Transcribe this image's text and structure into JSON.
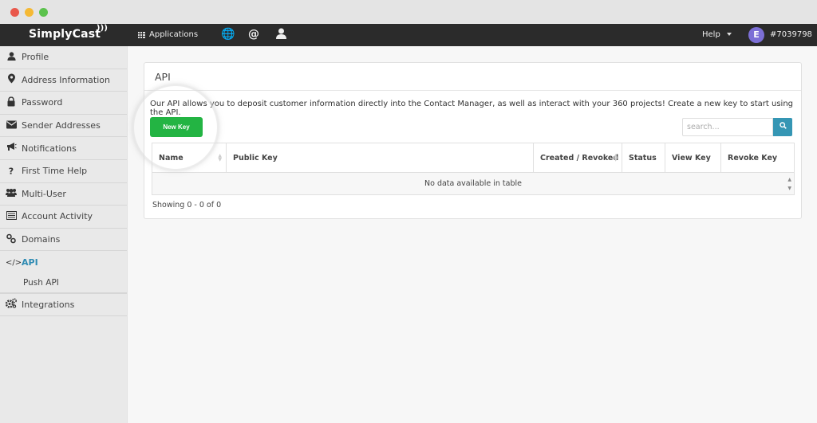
{
  "window": {
    "controls": [
      "close",
      "minimize",
      "maximize"
    ]
  },
  "topnav": {
    "logo": "SimplyCast",
    "applications_label": "Applications",
    "icons": [
      "globe-icon",
      "at-icon",
      "user-icon"
    ],
    "help_label": "Help",
    "avatar_letter": "E",
    "account_id": "#7039798",
    "avatar_color": "#7c6fd6"
  },
  "sidebar": {
    "items": [
      {
        "label": "Profile",
        "icon": "user-icon"
      },
      {
        "label": "Address Information",
        "icon": "map-marker-icon"
      },
      {
        "label": "Password",
        "icon": "lock-icon"
      },
      {
        "label": "Sender Addresses",
        "icon": "envelope-icon"
      },
      {
        "label": "Notifications",
        "icon": "bullhorn-icon"
      },
      {
        "label": "First Time Help",
        "icon": "question-icon"
      },
      {
        "label": "Multi-User",
        "icon": "users-icon"
      },
      {
        "label": "Account Activity",
        "icon": "list-icon"
      },
      {
        "label": "Domains",
        "icon": "link-icon"
      },
      {
        "label": "API",
        "icon": "code-icon",
        "active": true
      },
      {
        "label": "Push API",
        "sub": true
      },
      {
        "label": "Integrations",
        "icon": "cogs-icon"
      }
    ],
    "active_color": "#2e8bb3"
  },
  "panel": {
    "title": "API",
    "intro": "Our API allows you to deposit customer information directly into the Contact Manager, as well as interact with your 360 projects! Create a new key to start using the API.",
    "new_key_label": "New Key",
    "new_key_color": "#23b443",
    "search_placeholder": "search...",
    "table": {
      "columns": [
        "Name",
        "Public Key",
        "Created / Revoked",
        "Status",
        "View Key",
        "Revoke Key"
      ],
      "empty_message": "No data available in table"
    },
    "showing": "Showing 0 - 0 of 0"
  }
}
